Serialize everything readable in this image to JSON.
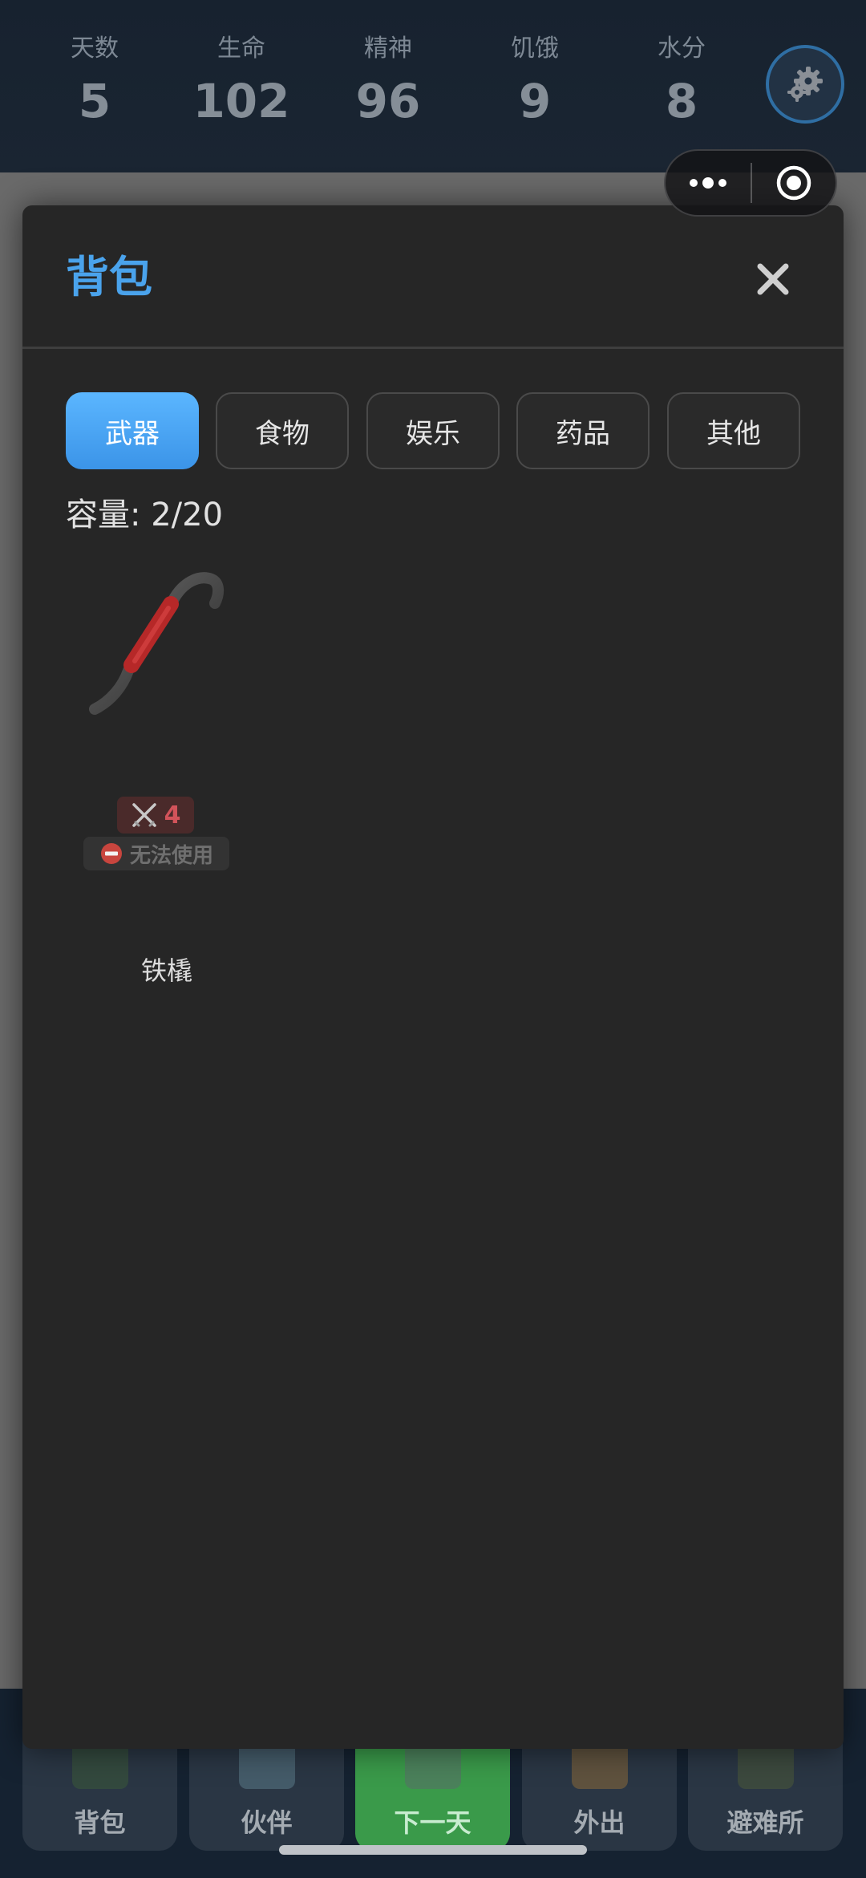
{
  "stats": [
    {
      "label": "天数",
      "value": "5"
    },
    {
      "label": "生命",
      "value": "102"
    },
    {
      "label": "精神",
      "value": "96"
    },
    {
      "label": "饥饿",
      "value": "9"
    },
    {
      "label": "水分",
      "value": "8"
    }
  ],
  "settings": {
    "icon": "gear-icon"
  },
  "capsule": {
    "more_icon": "more-dots-icon",
    "close_icon": "target-circle-icon"
  },
  "modal": {
    "title": "背包",
    "close_icon": "close-x-icon",
    "tabs": [
      {
        "label": "武器",
        "active": true
      },
      {
        "label": "食物",
        "active": false
      },
      {
        "label": "娱乐",
        "active": false
      },
      {
        "label": "药品",
        "active": false
      },
      {
        "label": "其他",
        "active": false
      }
    ],
    "capacity": "容量: 2/20",
    "items": [
      {
        "name": "铁橇",
        "icon": "crowbar-icon",
        "attack_icon": "crossed-swords-icon",
        "attack": "4",
        "status_icon": "no-entry-icon",
        "status": "无法使用"
      }
    ]
  },
  "bottom_nav": [
    {
      "label": "背包"
    },
    {
      "label": "伙伴"
    },
    {
      "label": "下一天"
    },
    {
      "label": "外出"
    },
    {
      "label": "避难所"
    }
  ],
  "colors": {
    "accent": "#4aa3ec",
    "tab_active": "#4aa8f8",
    "modal_bg": "#262626",
    "attack_red": "#d2535a",
    "next_day_green": "#3a9a4a"
  }
}
